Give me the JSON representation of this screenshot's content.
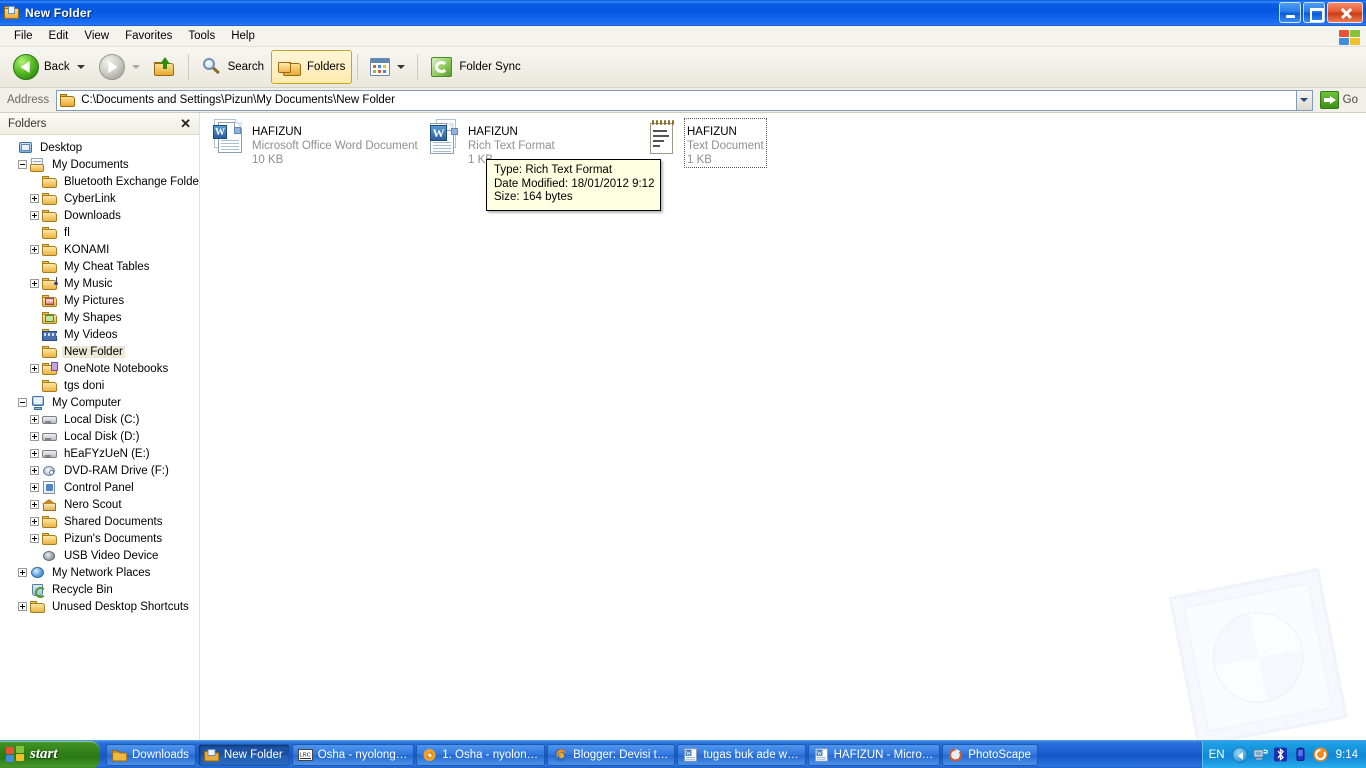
{
  "window": {
    "title": "New Folder",
    "title_icon": "folder-open-icon",
    "buttons": {
      "minimize": "minimize-button",
      "restore": "restore-button",
      "close": "close-button"
    }
  },
  "menubar": {
    "items": [
      "File",
      "Edit",
      "View",
      "Favorites",
      "Tools",
      "Help"
    ],
    "logo": "windows-flag-icon"
  },
  "toolbar": {
    "back": "Back",
    "forward": "",
    "up": "",
    "search": "Search",
    "folders": "Folders",
    "views": "",
    "folder_sync": "Folder Sync"
  },
  "address": {
    "label": "Address",
    "value": "C:\\Documents and Settings\\Pizun\\My Documents\\New Folder",
    "go": "Go"
  },
  "folders_pane": {
    "header": "Folders",
    "close": "✕",
    "tree": [
      {
        "label": "Desktop",
        "indent": 0,
        "expander": "none",
        "icon": "desktop-icon",
        "selected": false
      },
      {
        "label": "My Documents",
        "indent": 1,
        "expander": "minus",
        "icon": "my-documents-icon",
        "selected": false
      },
      {
        "label": "Bluetooth Exchange Folder",
        "indent": 2,
        "expander": "none",
        "icon": "folder-icon",
        "selected": false
      },
      {
        "label": "CyberLink",
        "indent": 2,
        "expander": "plus",
        "icon": "folder-icon",
        "selected": false
      },
      {
        "label": "Downloads",
        "indent": 2,
        "expander": "plus",
        "icon": "folder-icon",
        "selected": false
      },
      {
        "label": "fl",
        "indent": 2,
        "expander": "none",
        "icon": "folder-icon",
        "selected": false
      },
      {
        "label": "KONAMI",
        "indent": 2,
        "expander": "plus",
        "icon": "folder-icon",
        "selected": false
      },
      {
        "label": "My Cheat Tables",
        "indent": 2,
        "expander": "none",
        "icon": "folder-icon",
        "selected": false
      },
      {
        "label": "My Music",
        "indent": 2,
        "expander": "plus",
        "icon": "my-music-icon",
        "selected": false
      },
      {
        "label": "My Pictures",
        "indent": 2,
        "expander": "none",
        "icon": "my-pictures-icon",
        "selected": false
      },
      {
        "label": "My Shapes",
        "indent": 2,
        "expander": "none",
        "icon": "my-shapes-icon",
        "selected": false
      },
      {
        "label": "My Videos",
        "indent": 2,
        "expander": "none",
        "icon": "my-videos-icon",
        "selected": false
      },
      {
        "label": "New Folder",
        "indent": 2,
        "expander": "none",
        "icon": "folder-icon",
        "selected": true
      },
      {
        "label": "OneNote Notebooks",
        "indent": 2,
        "expander": "plus",
        "icon": "onenote-folder-icon",
        "selected": false
      },
      {
        "label": "tgs doni",
        "indent": 2,
        "expander": "none",
        "icon": "folder-icon",
        "selected": false
      },
      {
        "label": "My Computer",
        "indent": 1,
        "expander": "minus",
        "icon": "my-computer-icon",
        "selected": false
      },
      {
        "label": "Local Disk (C:)",
        "indent": 2,
        "expander": "plus",
        "icon": "hard-drive-icon",
        "selected": false
      },
      {
        "label": "Local Disk (D:)",
        "indent": 2,
        "expander": "plus",
        "icon": "hard-drive-icon",
        "selected": false
      },
      {
        "label": "hEaFYzUeN (E:)",
        "indent": 2,
        "expander": "plus",
        "icon": "hard-drive-icon",
        "selected": false
      },
      {
        "label": "DVD-RAM Drive (F:)",
        "indent": 2,
        "expander": "plus",
        "icon": "dvd-drive-icon",
        "selected": false
      },
      {
        "label": "Control Panel",
        "indent": 2,
        "expander": "plus",
        "icon": "control-panel-icon",
        "selected": false
      },
      {
        "label": "Nero Scout",
        "indent": 2,
        "expander": "plus",
        "icon": "nero-scout-icon",
        "selected": false
      },
      {
        "label": "Shared Documents",
        "indent": 2,
        "expander": "plus",
        "icon": "folder-icon",
        "selected": false
      },
      {
        "label": "Pizun's Documents",
        "indent": 2,
        "expander": "plus",
        "icon": "folder-icon",
        "selected": false
      },
      {
        "label": "USB Video Device",
        "indent": 2,
        "expander": "none",
        "icon": "usb-video-icon",
        "selected": false
      },
      {
        "label": "My Network Places",
        "indent": 1,
        "expander": "plus",
        "icon": "network-icon",
        "selected": false
      },
      {
        "label": "Recycle Bin",
        "indent": 1,
        "expander": "none",
        "icon": "recycle-bin-icon",
        "selected": false
      },
      {
        "label": "Unused Desktop Shortcuts",
        "indent": 1,
        "expander": "plus",
        "icon": "folder-icon",
        "selected": false
      }
    ]
  },
  "files": [
    {
      "name": "HAFIZUN",
      "type": "Microsoft Office Word Document",
      "size": "10 KB",
      "icon": "word-document-icon",
      "focused": false
    },
    {
      "name": "HAFIZUN",
      "type": "Rich Text Format",
      "size": "1 KB",
      "icon": "rich-text-document-icon",
      "focused": false
    },
    {
      "name": "HAFIZUN",
      "type": "Text Document",
      "size": "1 KB",
      "icon": "text-document-icon",
      "focused": true
    }
  ],
  "tooltip": {
    "line1": "Type: Rich Text Format",
    "line2": "Date Modified: 18/01/2012 9:12",
    "line3": "Size: 164 bytes"
  },
  "taskbar": {
    "start": "start",
    "tasks": [
      {
        "label": "Downloads",
        "icon": "folder-icon",
        "active": false
      },
      {
        "label": "New Folder",
        "icon": "folder-open-icon",
        "active": true
      },
      {
        "label": "Osha - nyolong…",
        "icon": "lrc-icon",
        "active": false
      },
      {
        "label": "1. Osha - nyolon…",
        "icon": "media-icon",
        "active": false
      },
      {
        "label": "Blogger: Devisi t…",
        "icon": "firefox-icon",
        "active": false
      },
      {
        "label": "tugas buk ade w…",
        "icon": "word-icon",
        "active": false
      },
      {
        "label": "HAFIZUN - Micro…",
        "icon": "word-icon",
        "active": false
      },
      {
        "label": "PhotoScape",
        "icon": "photoscape-icon",
        "active": false
      }
    ],
    "tray": {
      "language": "EN",
      "icons": [
        "show-hidden-icons-chevron",
        "network-icon",
        "bluetooth-icon",
        "battery-icon",
        "photoscape-tray-icon"
      ],
      "clock": "9:14"
    }
  },
  "colors": {
    "titlebar_blue": "#0a5fe2",
    "selection": "#ece9d8",
    "tooltip_bg": "#ffffe1",
    "taskbar_blue": "#1356c6",
    "start_green": "#2f7d16"
  }
}
